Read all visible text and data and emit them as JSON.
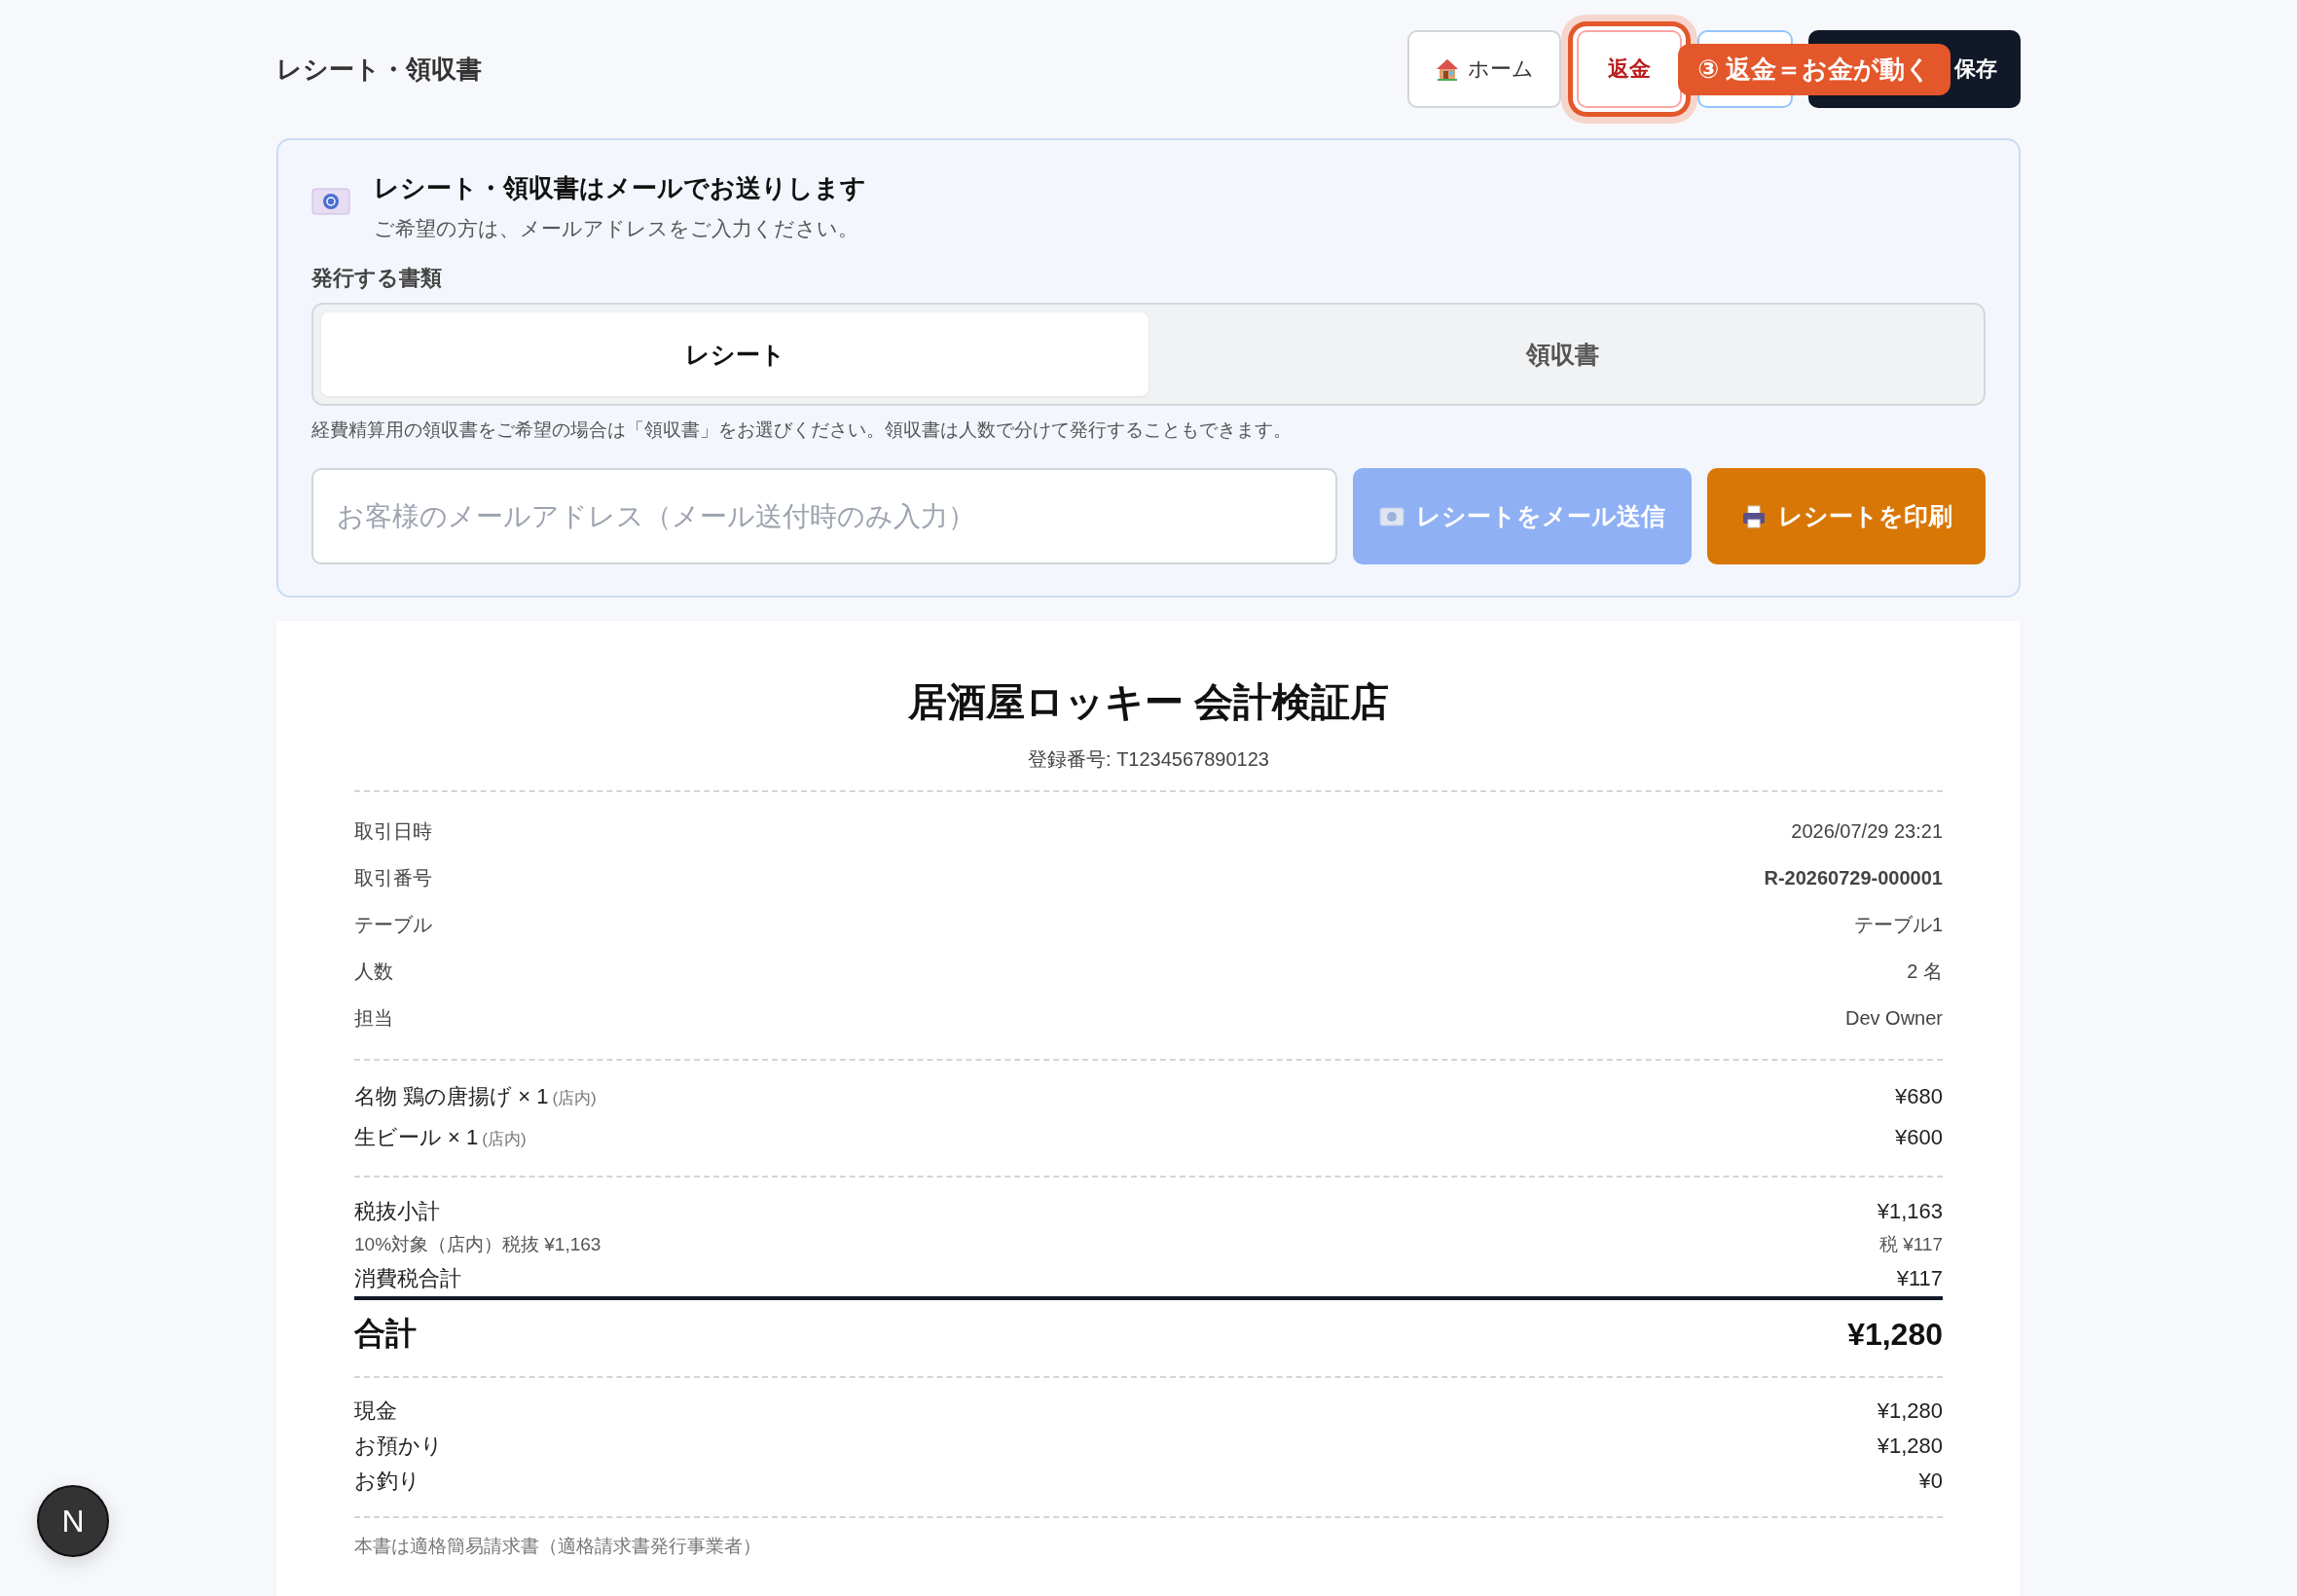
{
  "page_title": "レシート・領収書",
  "header_buttons": [
    {
      "kind": "home",
      "label": "ホーム",
      "highlighted": false
    },
    {
      "kind": "refund",
      "label": "返金",
      "highlighted": true
    },
    {
      "kind": "blank",
      "highlighted": false
    },
    {
      "kind": "save",
      "label": "保存",
      "highlighted": false
    }
  ],
  "tooltip": "③ 返金＝お金が動く",
  "email_card": {
    "title": "レシート・領収書はメールでお送りします",
    "subtitle": "ご希望の方は、メールアドレスをご入力ください。",
    "doc_type_label": "発行する書類",
    "doc_types": [
      {
        "label": "レシート",
        "selected": true
      },
      {
        "label": "領収書",
        "selected": false
      }
    ],
    "note": "経費精算用の領収書をご希望の場合は「領収書」をお選びください。領収書は人数で分けて発行することもできます。",
    "email_field": {
      "placeholder": "お客様のメールアドレス（メール送付時のみ入力）"
    },
    "send_button": {
      "label": "レシートをメール送信",
      "disabled": true
    },
    "print_button": {
      "label": "レシートを印刷"
    }
  },
  "receipt": {
    "store_name": "居酒屋ロッキー 会計検証店",
    "registration": "登録番号: T1234567890123",
    "info": [
      {
        "label": "取引日時",
        "value": "2026/07/29 23:21",
        "bold": false
      },
      {
        "label": "取引番号",
        "value": "R-20260729-000001",
        "bold": true
      },
      {
        "label": "テーブル",
        "value": "テーブル1",
        "bold": false
      },
      {
        "label": "人数",
        "value": "2 名",
        "bold": false
      },
      {
        "label": "担当",
        "value": "Dev Owner",
        "bold": false
      }
    ],
    "items": [
      {
        "name": "名物 鶏の唐揚げ × 1",
        "tag": "(店内)",
        "price": "¥680"
      },
      {
        "name": "生ビール × 1",
        "tag": "(店内)",
        "price": "¥600"
      }
    ],
    "tax_rows": [
      {
        "kind": "main",
        "label": "税抜小計",
        "value": "¥1,163"
      },
      {
        "kind": "sub",
        "label": "10%対象（店内）税抜 ¥1,163",
        "value": "税 ¥117"
      },
      {
        "kind": "main",
        "label": "消費税合計",
        "value": "¥117"
      }
    ],
    "total": {
      "label": "合計",
      "value": "¥1,280"
    },
    "payments": [
      {
        "label": "現金",
        "value": "¥1,280"
      },
      {
        "label": "お預かり",
        "value": "¥1,280"
      },
      {
        "label": "お釣り",
        "value": "¥0"
      }
    ],
    "footer_note": "本書は適格簡易請求書（適格請求書発行事業者）"
  },
  "dev_badge": "N"
}
